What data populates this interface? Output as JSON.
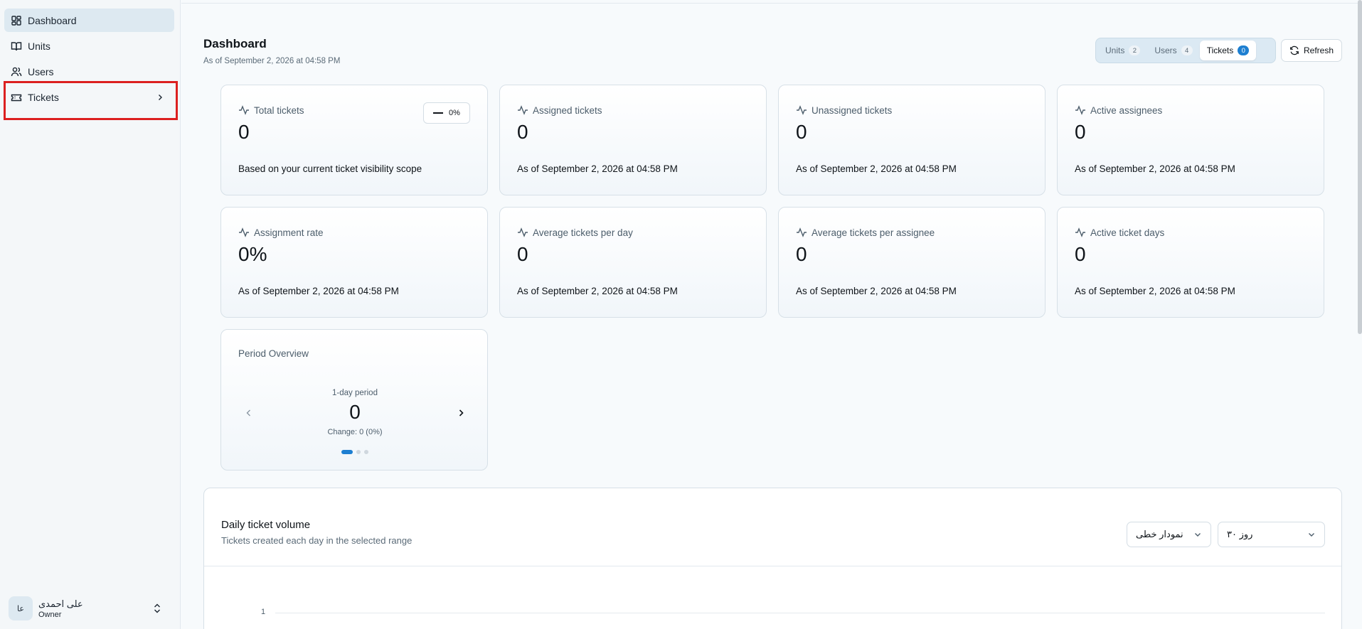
{
  "sidebar": {
    "items": [
      {
        "label": "Dashboard",
        "icon": "dashboard-icon",
        "active": true
      },
      {
        "label": "Units",
        "icon": "book-icon"
      },
      {
        "label": "Users",
        "icon": "users-icon"
      },
      {
        "label": "Tickets",
        "icon": "ticket-icon"
      }
    ],
    "user": {
      "initials": "عا",
      "name": "علی احمدی",
      "role": "Owner"
    }
  },
  "header": {
    "title": "Dashboard",
    "subtitle": "As of September 2, 2026 at 04:58 PM",
    "tabs": [
      {
        "label": "Units",
        "count": "2"
      },
      {
        "label": "Users",
        "count": "4"
      },
      {
        "label": "Tickets",
        "count": "0",
        "active": true
      }
    ],
    "refresh_label": "Refresh"
  },
  "cards": [
    {
      "label": "Total tickets",
      "value": "0",
      "note": "Based on your current ticket visibility scope",
      "trend": "0%"
    },
    {
      "label": "Assigned tickets",
      "value": "0",
      "note": "As of September 2, 2026 at 04:58 PM"
    },
    {
      "label": "Unassigned tickets",
      "value": "0",
      "note": "As of September 2, 2026 at 04:58 PM"
    },
    {
      "label": "Active assignees",
      "value": "0",
      "note": "As of September 2, 2026 at 04:58 PM"
    },
    {
      "label": "Assignment rate",
      "value": "0%",
      "note": "As of September 2, 2026 at 04:58 PM"
    },
    {
      "label": "Average tickets per day",
      "value": "0",
      "note": "As of September 2, 2026 at 04:58 PM"
    },
    {
      "label": "Average tickets per assignee",
      "value": "0",
      "note": "As of September 2, 2026 at 04:58 PM"
    },
    {
      "label": "Active ticket days",
      "value": "0",
      "note": "As of September 2, 2026 at 04:58 PM"
    }
  ],
  "period": {
    "title": "Period Overview",
    "label": "1-day period",
    "value": "0",
    "change": "Change: 0 (0%)",
    "slides": 3,
    "active_slide": 0
  },
  "chart_panel": {
    "title": "Daily ticket volume",
    "subtitle": "Tickets created each day in the selected range",
    "chart_type_select": "نمودار خطی",
    "range_select": "۳۰ روز",
    "y_tick": "1"
  },
  "colors": {
    "accent": "#1d7fd1",
    "highlight": "#dc2020"
  }
}
